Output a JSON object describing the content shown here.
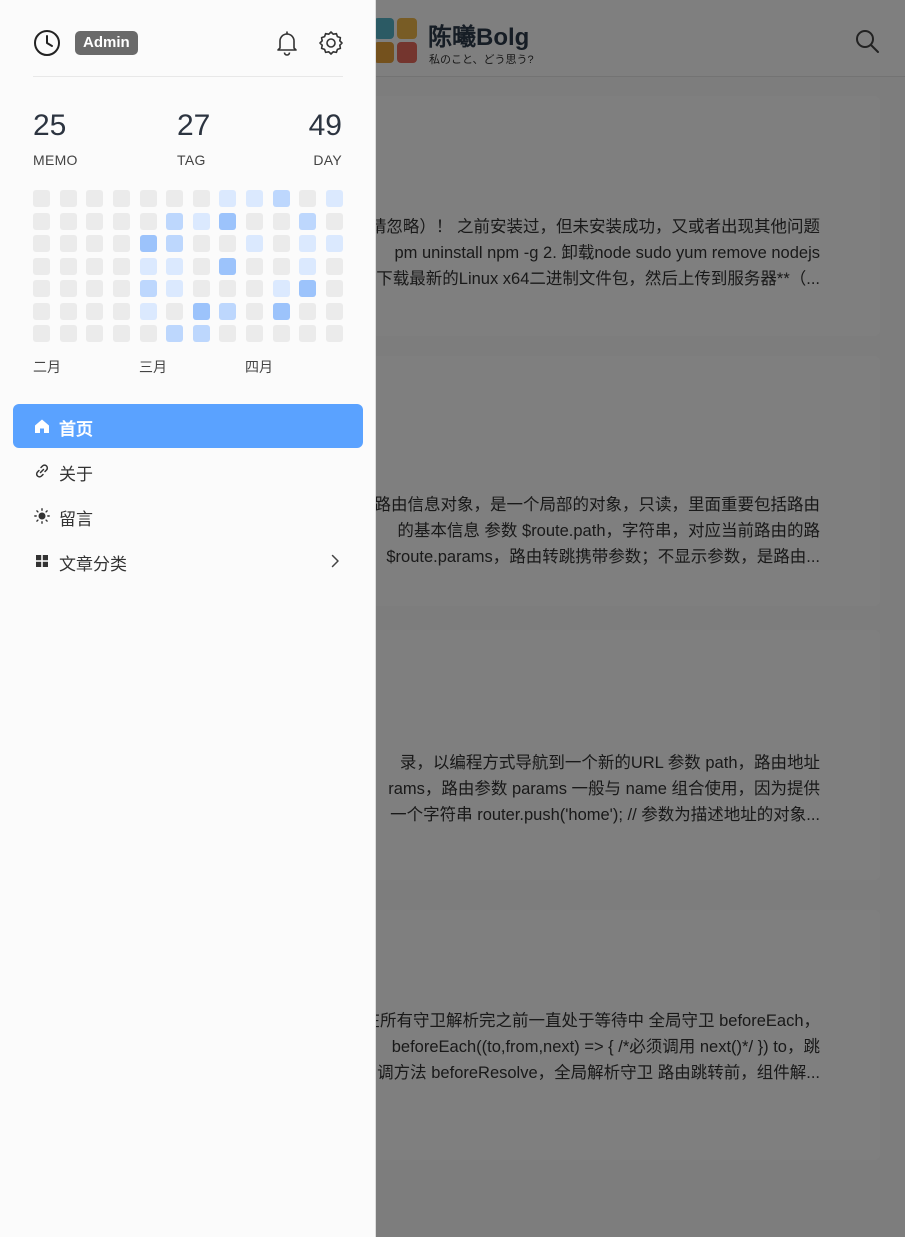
{
  "site": {
    "title": "陈曦Bolg",
    "subtitle": "私のこと、どう思う?",
    "logo_colors": [
      "#56b5c9",
      "#d65a4c",
      "#f0b94b",
      "#e96a5c"
    ]
  },
  "posts": [
    {
      "lines": [
        "装请忽略）！ 之前安装过，但未安装成功，又或者出现其他问题",
        "pm uninstall npm -g 2. 卸载node sudo yum remove nodejs",
        "下载最新的Linux x64二进制文件包，然后上传到服务器**（..."
      ]
    },
    {
      "lines": [
        "路由信息对象，是一个局部的对象，只读，里面重要包括路由",
        "的基本信息 参数 $route.path，字符串，对应当前路由的路",
        "$route.params，路由转跳携带参数；不显示参数，是路由..."
      ]
    },
    {
      "lines": [
        "录，以编程方式导航到一个新的URL 参数 path，路由地址",
        "rams，路由参数 params 一般与 name 组合使用，因为提供",
        "一个字符串 router.push('home'); // 参数为描述地址的对象..."
      ]
    },
    {
      "lines": [
        "在所有守卫解析完之前一直处于等待中 全局守卫 beforeEach，",
        "beforeEach((to,from,next) => { /*必须调用 next()*/ }) to，跳",
        "调方法 beforeResolve，全局解析守卫 路由跳转前，组件解..."
      ]
    }
  ],
  "drawer": {
    "badge": "Admin",
    "stats": [
      {
        "value": "25",
        "label": "MEMO"
      },
      {
        "value": "27",
        "label": "TAG"
      },
      {
        "value": "49",
        "label": "DAY"
      }
    ],
    "heatmap": {
      "rows": 7,
      "cols": 12,
      "levels": [
        [
          0,
          0,
          0,
          0,
          0,
          0,
          0,
          1,
          1,
          2,
          0,
          1
        ],
        [
          0,
          0,
          0,
          0,
          0,
          2,
          1,
          3,
          0,
          0,
          2,
          0
        ],
        [
          0,
          0,
          0,
          0,
          3,
          2,
          0,
          0,
          1,
          0,
          1,
          1
        ],
        [
          0,
          0,
          0,
          0,
          1,
          1,
          0,
          3,
          0,
          0,
          1,
          0
        ],
        [
          0,
          0,
          0,
          0,
          2,
          1,
          0,
          0,
          0,
          1,
          3,
          0
        ],
        [
          0,
          0,
          0,
          0,
          1,
          0,
          3,
          2,
          0,
          3,
          0,
          0
        ],
        [
          0,
          0,
          0,
          0,
          0,
          2,
          2,
          0,
          0,
          0,
          0,
          0
        ]
      ],
      "level_colors": [
        "#ebebeb",
        "#dbe9fe",
        "#bdd7fd",
        "#9cc3fb"
      ]
    },
    "months": [
      "二月",
      "三月",
      "四月"
    ],
    "nav": [
      {
        "label": "首页",
        "icon": "home-icon",
        "active": true
      },
      {
        "label": "关于",
        "icon": "link-icon",
        "active": false
      },
      {
        "label": "留言",
        "icon": "sun-icon",
        "active": false
      },
      {
        "label": "文章分类",
        "icon": "grid-icon",
        "active": false,
        "has_submenu": true
      }
    ]
  }
}
